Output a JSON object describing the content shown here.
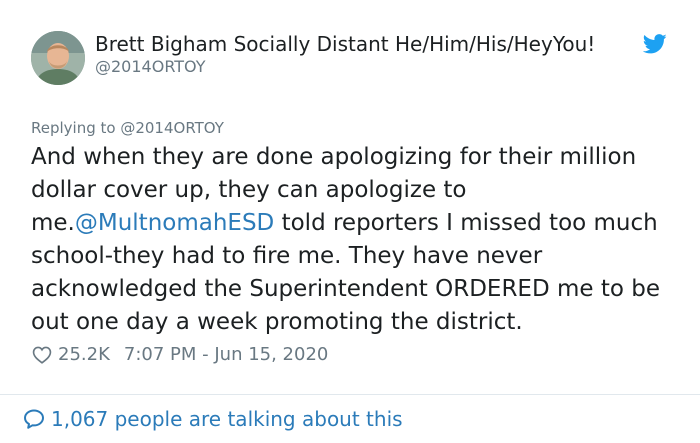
{
  "author": {
    "display_name": "Brett Bigham Socially Distant He/Him/His/HeyYou!",
    "handle": "@2014ORTOY"
  },
  "reply": {
    "text": "Replying to @2014ORTOY"
  },
  "tweet": {
    "text_part1": "And when they are done apologizing for their million dollar cover up, they can apologize to me.",
    "mention": "@MultnomahESD",
    "text_part2": " told reporters I missed too much school-they had to fire me. They have never acknowledged the Superintendent ORDERED me to be out one day a week promoting the district.",
    "likes": "25.2K",
    "timestamp": "7:07 PM - Jun 15, 2020"
  },
  "footer": {
    "talking_text": "1,067 people are talking about this"
  },
  "icons": {
    "brand": "twitter-bird-icon",
    "like": "heart-icon",
    "comment": "speech-bubble-icon"
  },
  "colors": {
    "link": "#2b7bb9",
    "twitter_blue": "#1da1f2",
    "muted": "#697882",
    "text": "#1c2022"
  }
}
